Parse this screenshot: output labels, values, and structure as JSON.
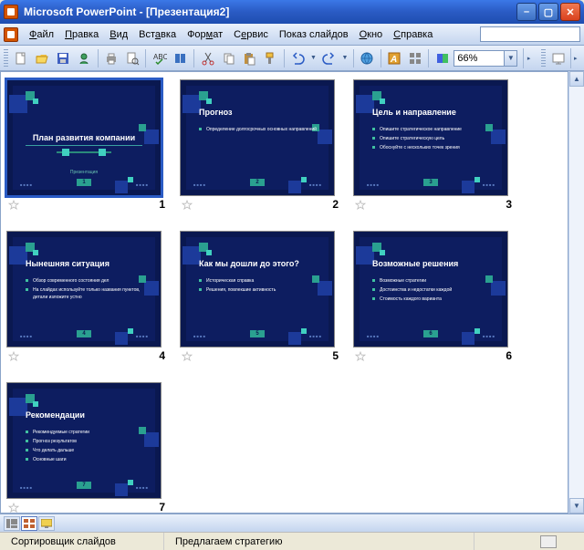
{
  "window": {
    "title": "Microsoft PowerPoint - [Презентация2]"
  },
  "menu": {
    "file": "Файл",
    "edit": "Правка",
    "view": "Вид",
    "insert": "Вставка",
    "format": "Формат",
    "tools": "Сервис",
    "slideshow": "Показ слайдов",
    "window": "Окно",
    "help": "Справка"
  },
  "toolbar": {
    "zoom": "66%"
  },
  "slides": [
    {
      "num": "1",
      "title": "План развития компании",
      "subtitle": "Презентация",
      "layout": "title",
      "bullets": []
    },
    {
      "num": "2",
      "title": "Прогноз",
      "layout": "content",
      "bullets": [
        "Определение долгосрочных основных направлений"
      ]
    },
    {
      "num": "3",
      "title": "Цель и направление",
      "layout": "content",
      "bullets": [
        "Опишите стратегическое направление",
        "Опишите стратегическую цель",
        "Обоснуйте с нескольких точек зрения"
      ]
    },
    {
      "num": "4",
      "title": "Нынешняя ситуация",
      "layout": "content",
      "bullets": [
        "Обзор современного состояния дел",
        "На слайдах используйте только названия пунктов, детали изложите устно"
      ]
    },
    {
      "num": "5",
      "title": "Как мы дошли до этого?",
      "layout": "content",
      "bullets": [
        "Историческая справка",
        "Решения, повлекшие активность"
      ]
    },
    {
      "num": "6",
      "title": "Возможные решения",
      "layout": "content",
      "bullets": [
        "Возможные стратегии",
        "Достоинства и недостатки каждой",
        "Стоимость каждого варианта"
      ]
    },
    {
      "num": "7",
      "title": "Рекомендации",
      "layout": "content",
      "bullets": [
        "Рекомендуемые стратегии",
        "Прогноз результатов",
        "Что делать дальше",
        "Основные шаги"
      ]
    }
  ],
  "status": {
    "view": "Сортировщик слайдов",
    "design": "Предлагаем стратегию"
  }
}
